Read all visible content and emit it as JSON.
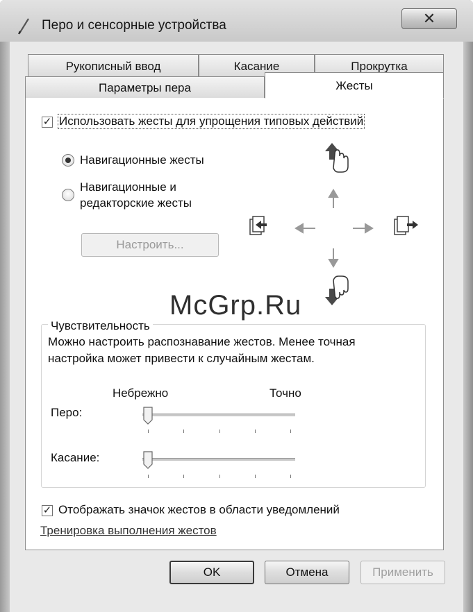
{
  "window": {
    "title": "Перо и сенсорные устройства",
    "close_label": "✕"
  },
  "tabs": {
    "row_back": [
      {
        "label": "Рукописный ввод"
      },
      {
        "label": "Касание"
      },
      {
        "label": "Прокрутка"
      }
    ],
    "row_front": [
      {
        "label": "Параметры пера"
      },
      {
        "label": "Жесты",
        "selected": true
      }
    ]
  },
  "gestures": {
    "use_gestures": {
      "label": "Использовать жесты для упрощения типовых действий",
      "checked": true
    },
    "radio_nav": {
      "label": "Навигационные жесты",
      "selected": true
    },
    "radio_nav_edit": {
      "line1": "Навигационные и",
      "line2": "редакторские жесты",
      "selected": false
    },
    "configure_button": "Настроить...",
    "sensitivity": {
      "title": "Чувствительность",
      "desc_line1": "Можно настроить распознавание жестов. Менее точная",
      "desc_line2": "настройка может привести к случайным жестам.",
      "label_loose": "Небрежно",
      "label_precise": "Точно",
      "pen_label": "Перо:",
      "touch_label": "Касание:",
      "pen_value": 0,
      "touch_value": 0
    },
    "show_icon": {
      "label": "Отображать значок жестов в области уведомлений",
      "checked": true
    },
    "training_link": "Тренировка выполнения жестов"
  },
  "watermark": "McGrp.Ru",
  "buttons": {
    "ok": "OK",
    "cancel": "Отмена",
    "apply": "Применить"
  },
  "icons": {
    "app": "pen-icon",
    "up": "hand-up-icon",
    "down": "hand-down-icon",
    "left": "page-back-icon",
    "right": "page-forward-icon"
  }
}
